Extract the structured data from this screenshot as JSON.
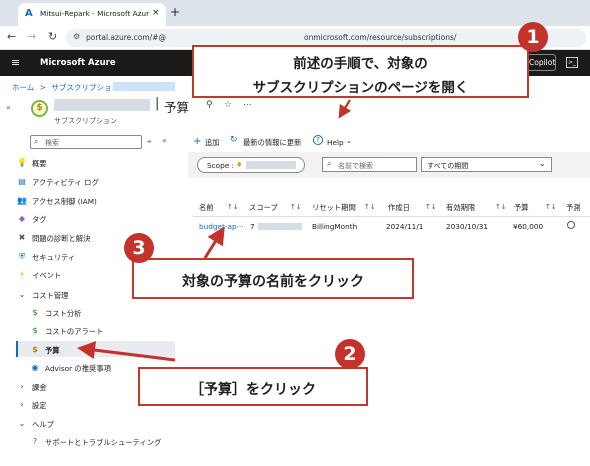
{
  "browser": {
    "tab_title": "Mitsui-Repark - Microsoft Azur",
    "new_tab": "+",
    "url_prefix": "portal.azure.com/#@",
    "url_mid": "onmicrosoft.com/resource/subscriptions/"
  },
  "azure_header": {
    "brand": "Microsoft Azure",
    "copilot": "Copilot"
  },
  "breadcrumb": {
    "home": "ホーム",
    "sep": ">",
    "subs": "サブスクリプション"
  },
  "resource": {
    "title": "予算",
    "subtitle": "サブスクリプション",
    "more": "..."
  },
  "sidebar": {
    "search_placeholder": "検索",
    "items": [
      {
        "label": "概要",
        "icon": "lightbulb-icon"
      },
      {
        "label": "アクティビティ ログ",
        "icon": "log-icon"
      },
      {
        "label": "アクセス制御 (IAM)",
        "icon": "people-icon"
      },
      {
        "label": "タグ",
        "icon": "tag-icon"
      },
      {
        "label": "問題の診断と解決",
        "icon": "wrench-icon"
      },
      {
        "label": "セキュリティ",
        "icon": "shield-icon"
      },
      {
        "label": "イベント",
        "icon": "bolt-icon"
      },
      {
        "label": "コスト管理",
        "icon": "chevron-down-icon"
      },
      {
        "label": "コスト分析",
        "icon": "dollar-icon"
      },
      {
        "label": "コストのアラート",
        "icon": "dollar-alert-icon"
      },
      {
        "label": "予算",
        "icon": "budget-icon"
      },
      {
        "label": "Advisor の推奨事項",
        "icon": "advisor-icon"
      },
      {
        "label": "課金",
        "icon": "chevron-right-icon"
      },
      {
        "label": "設定",
        "icon": "chevron-right-icon"
      },
      {
        "label": "ヘルプ",
        "icon": "chevron-down-icon"
      },
      {
        "label": "サポートとトラブルシューティング",
        "icon": "help-icon"
      }
    ]
  },
  "toolbar": {
    "add": "追加",
    "refresh": "最新の情報に更新",
    "help": "Help"
  },
  "filters": {
    "scope_label": "Scope :",
    "name_search_placeholder": "名前で検索",
    "period": "すべての期間"
  },
  "table": {
    "columns": [
      "名前",
      "スコープ",
      "リセット期間",
      "作成日",
      "有効期限",
      "予算",
      "予測"
    ],
    "rows": [
      {
        "name": "budget-ap···",
        "scope": "7",
        "reset": "BillingMonth",
        "created": "2024/11/1",
        "expires": "2030/10/31",
        "budget": "¥60,000"
      }
    ]
  },
  "callouts": {
    "one_badge": "1",
    "one_line1": "前述の手順で、対象の",
    "one_line2": "サブスクリプションのページを開く",
    "two_badge": "2",
    "two_text": "［予算］をクリック",
    "three_badge": "3",
    "three_text": "対象の予算の名前をクリック"
  },
  "colors": {
    "accent": "#0f6cbd",
    "callout_red": "#c4322c",
    "azure_bar": "#1b1a19"
  }
}
